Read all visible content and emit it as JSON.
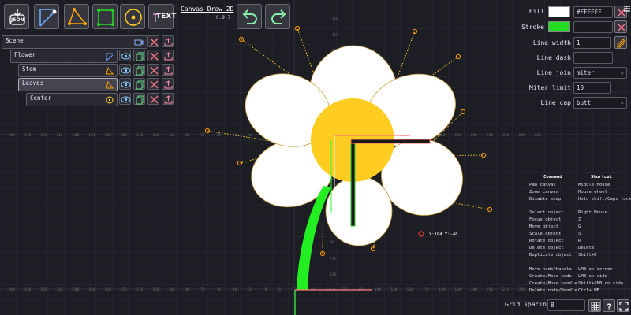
{
  "app": {
    "title": "Canvas Draw 2D",
    "version": "0.9.7"
  },
  "toolbar": {
    "json_label": "JSON",
    "text_label": "TEXT"
  },
  "layers": [
    {
      "label": "Scene"
    },
    {
      "label": "Flower"
    },
    {
      "label": "Stem"
    },
    {
      "label": "Leaves"
    },
    {
      "label": "Center"
    }
  ],
  "properties": {
    "fill_label": "Fill",
    "fill_hex": "#FFFFFF",
    "fill_color": "#FFFFFF",
    "stroke_label": "Stroke",
    "stroke_hex": "",
    "stroke_color": "#22DD22",
    "line_width_label": "Line width",
    "line_width": "1",
    "line_dash_label": "Line dash",
    "line_dash": "",
    "line_join_label": "Line join",
    "line_join": "miter",
    "miter_limit_label": "Miter limit",
    "miter_limit": "10",
    "line_cap_label": "Line cap",
    "line_cap": "butt"
  },
  "help": {
    "col_command": "Command",
    "col_shortcut": "Shortcut",
    "rows": [
      {
        "command": "Pan canvas",
        "shortcut": "Middle Mouse"
      },
      {
        "command": "Zoom canvas",
        "shortcut": "Mouse wheel"
      },
      {
        "command": "Disable snap",
        "shortcut": "Hold shift/Caps lock"
      },
      {
        "command": "Select object",
        "shortcut": "Right Mouse"
      },
      {
        "command": "Focus object",
        "shortcut": "Z"
      },
      {
        "command": "Move object",
        "shortcut": "G"
      },
      {
        "command": "Scale object",
        "shortcut": "S"
      },
      {
        "command": "Rotate object",
        "shortcut": "R"
      },
      {
        "command": "Delete object",
        "shortcut": "Delete"
      },
      {
        "command": "Duplicate object",
        "shortcut": "Shift+D"
      },
      {
        "command": "Move node/Handle",
        "shortcut": "LMB on corner"
      },
      {
        "command": "Create/Move node",
        "shortcut": "LMB on side"
      },
      {
        "command": "Create/Move handle",
        "shortcut": "Shift+LMB on side"
      },
      {
        "command": "Delete node/Handle",
        "shortcut": "Ctrl+LMB"
      }
    ]
  },
  "bottom": {
    "grid_label": "Grid spacing",
    "grid_value": "8"
  },
  "cursor_readout": "X:104 Y:-48",
  "axis": {
    "x_ticks": [
      "-264",
      "-248",
      "-232",
      "-216",
      "-200",
      "-184",
      "-168",
      "-152",
      "-136",
      "-120",
      "-104",
      "-88",
      "-72",
      "-56",
      "-40",
      "-24",
      "-8",
      "8",
      "24",
      "40",
      "56",
      "72",
      "88",
      "104",
      "120",
      "136",
      "152",
      "168",
      "184",
      "200",
      "216",
      "232",
      "248",
      "264"
    ],
    "y_ticks": [
      "-128",
      "-112",
      "-96",
      "-80",
      "-64",
      "-48",
      "-32",
      "-16",
      "0",
      "16",
      "32",
      "48",
      "64",
      "80",
      "96",
      "112",
      "128",
      "144"
    ]
  },
  "colors": {
    "background": "#1D1D24",
    "petal": "#FFFFFF",
    "center": "#FFCC22",
    "stem": "#22EE22",
    "handle": "#FF9900",
    "accent": "#FF6666"
  }
}
